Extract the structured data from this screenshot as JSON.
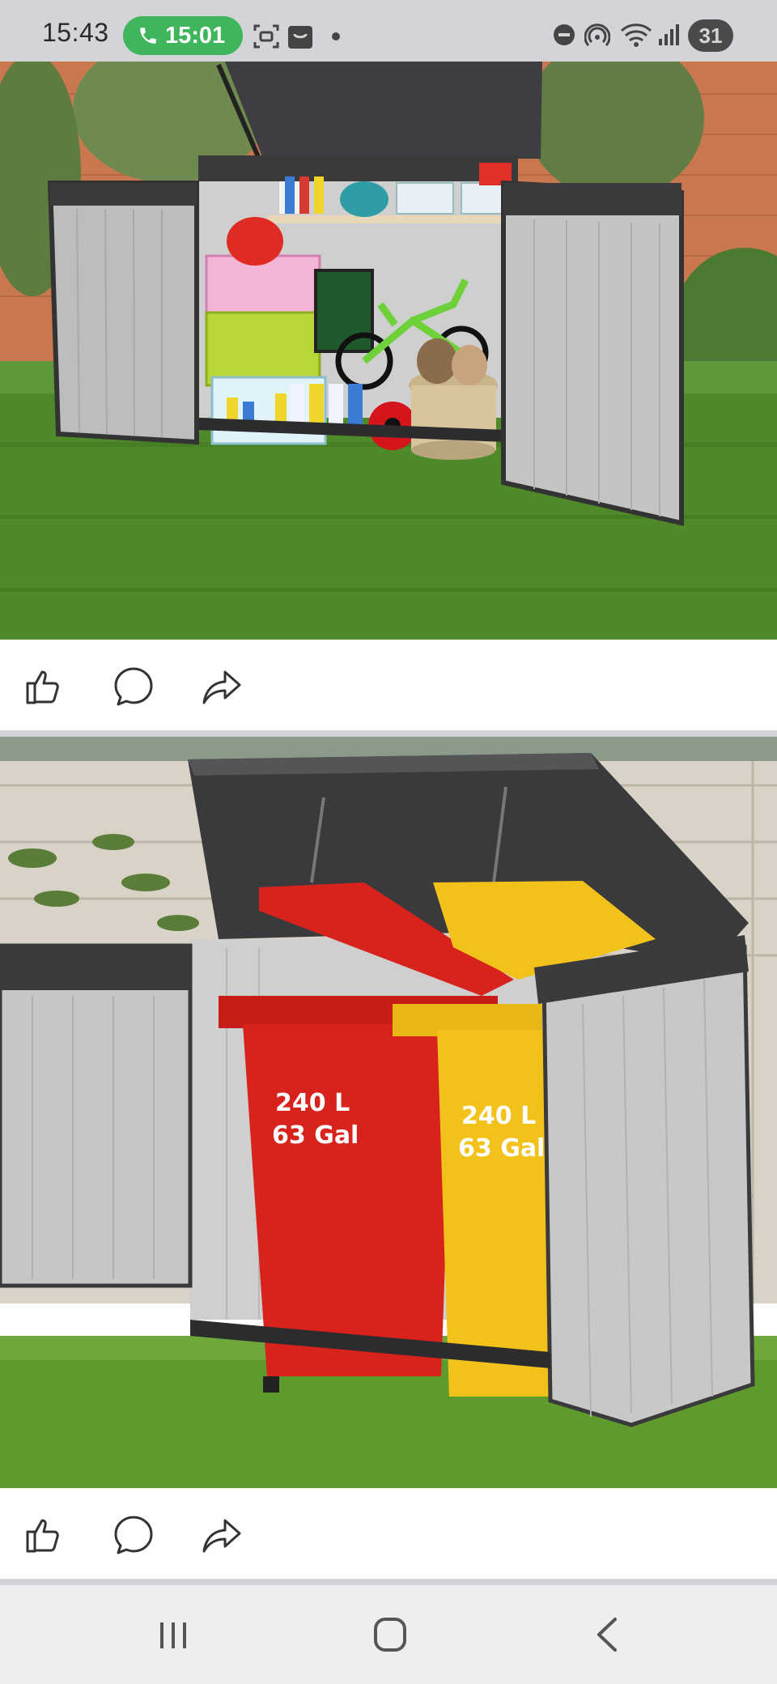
{
  "status_bar": {
    "time": "15:43",
    "call_timer": "15:01",
    "battery_level": "31",
    "icons": [
      "phone-icon",
      "screenshot-icon",
      "shopping-bag-icon",
      "do-not-disturb-icon",
      "hotspot-icon",
      "wifi-icon",
      "signal-icon",
      "battery-icon"
    ]
  },
  "posts": [
    {
      "image": "outdoor storage shed with toys and bicycle",
      "actions": [
        "like-icon",
        "comment-icon",
        "share-icon"
      ]
    },
    {
      "image": "storage shed with wheelie bins",
      "bin_labels": [
        {
          "line1": "240 L",
          "line2": "63 Gal"
        },
        {
          "line1": "240 L",
          "line2": "63 Gal"
        }
      ],
      "actions": [
        "like-icon",
        "comment-icon",
        "share-icon"
      ]
    }
  ],
  "nav_bar": {
    "buttons": [
      "recent-apps",
      "home",
      "back"
    ]
  },
  "colors": {
    "status_bar_bg": "#d3d4d8",
    "call_pill": "#3fb55c",
    "red_bin": "#d8221c",
    "yellow_bin": "#f2c21b",
    "grass": "#4f8a2a"
  }
}
